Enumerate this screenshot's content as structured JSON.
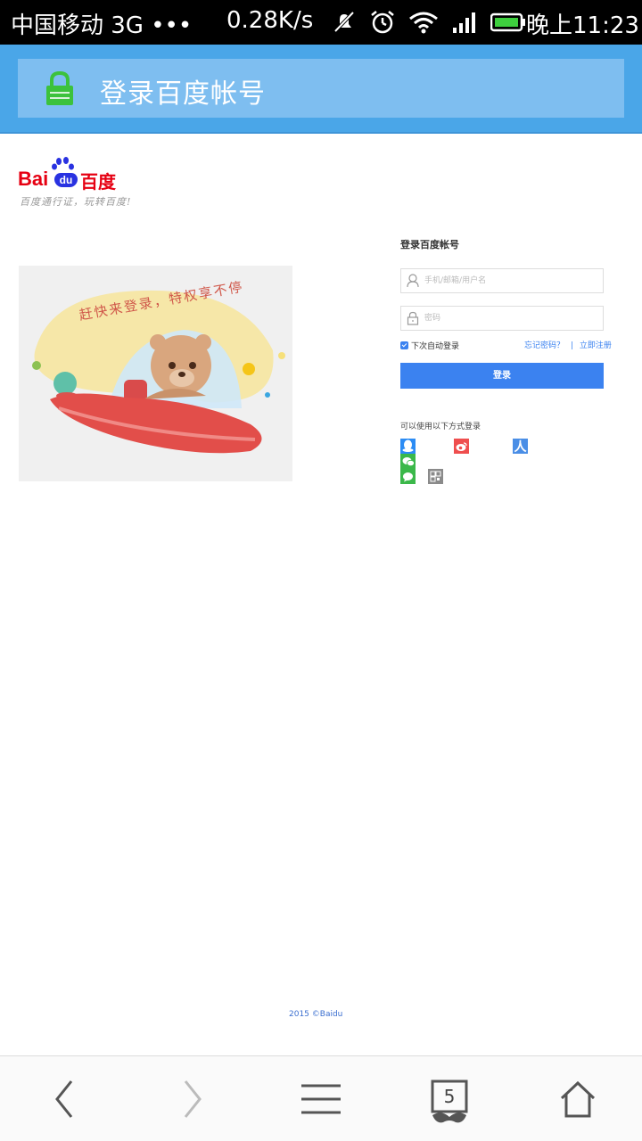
{
  "status_bar": {
    "carrier": "中国移动 3G •••",
    "speed": "0.28K/s",
    "time": "晚上11:23"
  },
  "header": {
    "title": "登录百度帐号",
    "icon": "lock-icon",
    "accent": "#4aa6e8"
  },
  "logo": {
    "bai": "Bai",
    "du": "du",
    "cn": "百度",
    "tagline": "百度通行证，玩转百度!"
  },
  "illustration": {
    "caption": "赶快来登录，特权享不停"
  },
  "login": {
    "title": "登录百度帐号",
    "username_placeholder": "手机/邮箱/用户名",
    "password_placeholder": "密码",
    "remember_label": "下次自动登录",
    "remember_checked": true,
    "forgot_label": "忘记密码？",
    "separator": "|",
    "register_label": "立即注册",
    "submit_label": "登录",
    "button_color": "#3b82f0"
  },
  "social": {
    "title": "可以使用以下方式登录",
    "renren_glyph": "人",
    "icons": [
      "qq-icon",
      "weibo-icon",
      "renren-icon",
      "wechat-icon",
      "message-icon",
      "qrcode-icon"
    ]
  },
  "footer": {
    "copyright": "2015 ©Baidu"
  },
  "nav": {
    "tab_count": "5",
    "icons": [
      "back-icon",
      "forward-icon",
      "menu-icon",
      "tabs-icon",
      "home-icon"
    ]
  }
}
